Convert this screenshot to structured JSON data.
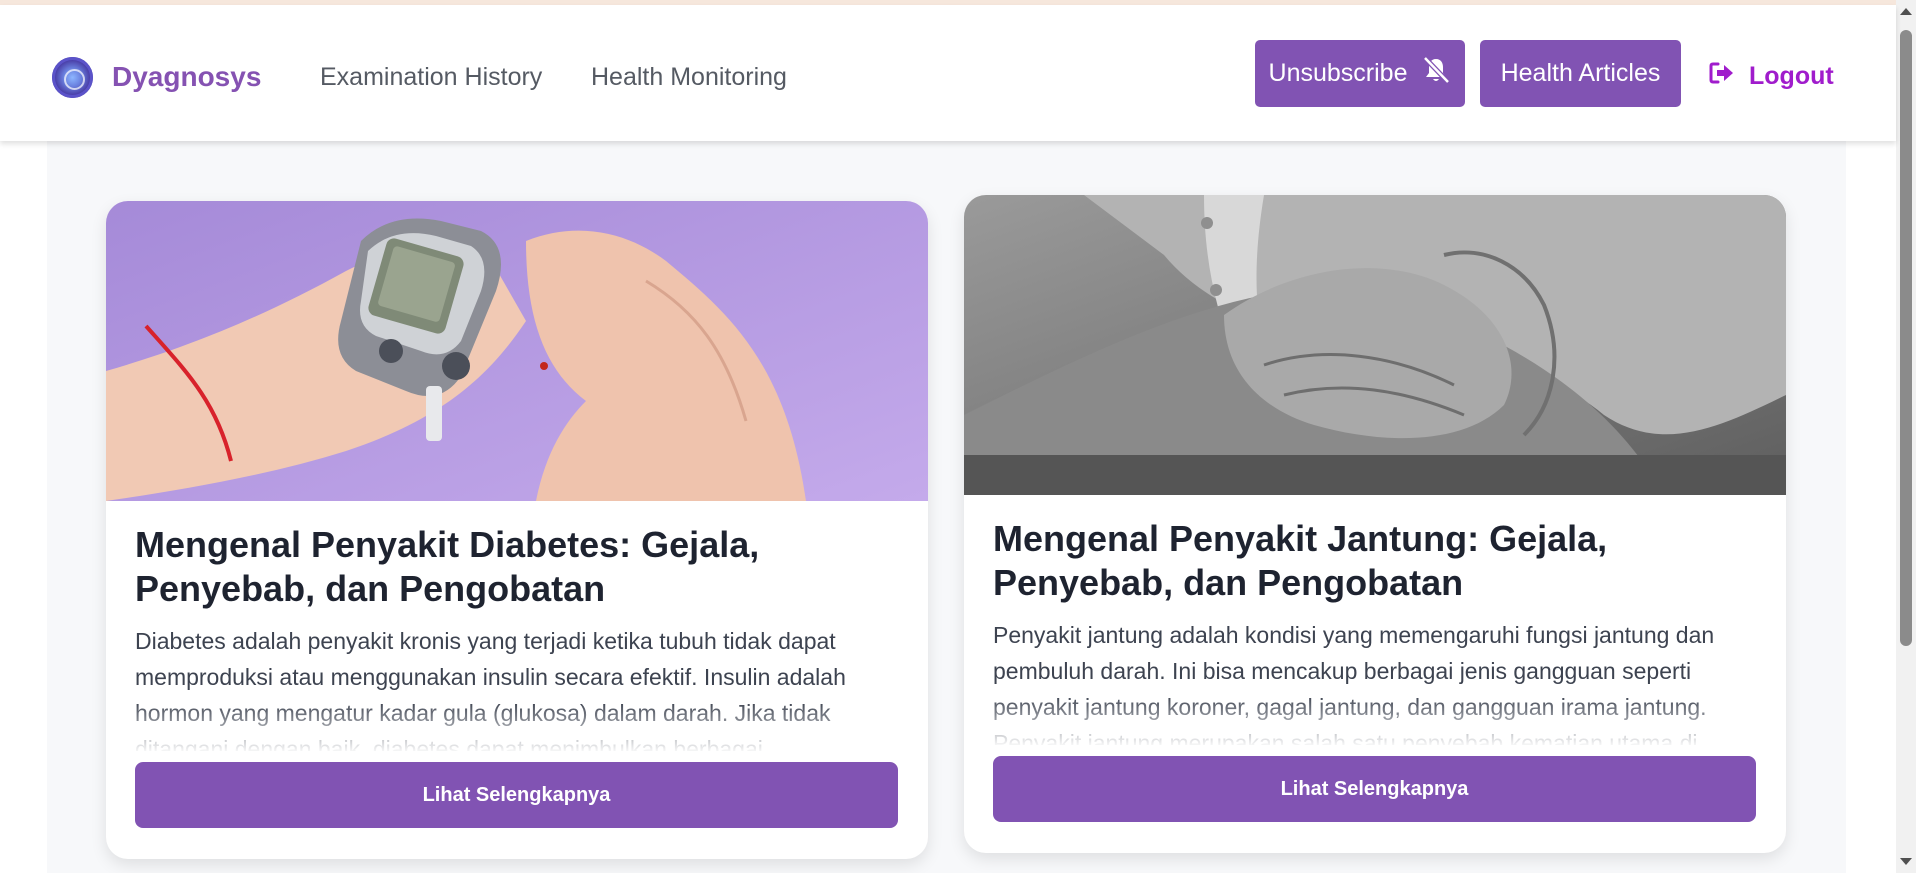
{
  "app": {
    "brand": "Dyagnosys"
  },
  "nav": {
    "links": [
      "Examination History",
      "Health Monitoring"
    ],
    "unsubscribe_label": "Unsubscribe",
    "articles_label": "Health Articles",
    "logout_label": "Logout"
  },
  "articles": [
    {
      "title": "Mengenal Penyakit Diabetes: Gejala, Penyebab, dan Pengobatan",
      "excerpt": "Diabetes adalah penyakit kronis yang terjadi ketika tubuh tidak dapat memproduksi atau menggunakan insulin secara efektif. Insulin adalah hormon yang mengatur kadar gula (glukosa) dalam darah. Jika tidak ditangani dengan baik, diabetes dapat menimbulkan berbagai",
      "button_label": "Lihat Selengkapnya"
    },
    {
      "title": "Mengenal Penyakit Jantung: Gejala, Penyebab, dan Pengobatan",
      "excerpt": "Penyakit jantung adalah kondisi yang memengaruhi fungsi jantung dan pembuluh darah. Ini bisa mencakup berbagai jenis gangguan seperti penyakit jantung koroner, gagal jantung, dan gangguan irama jantung. Penyakit jantung merupakan salah satu penyebab kematian utama di",
      "button_label": "Lihat Selengkapnya"
    }
  ],
  "colors": {
    "accent": "#8153b3",
    "brand_text": "#8552b2",
    "logout_text": "#a01ccc"
  }
}
